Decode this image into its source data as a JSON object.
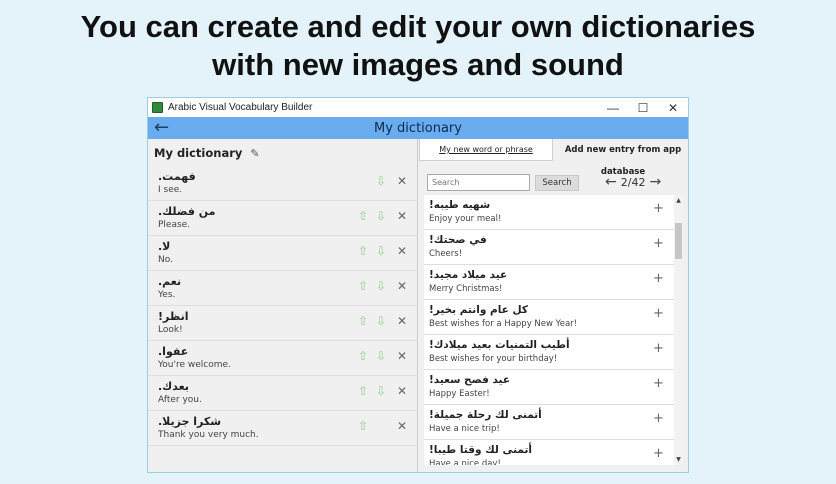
{
  "headline": {
    "line1": "You can create and edit your own dictionaries",
    "line2": "with new images and sound"
  },
  "window": {
    "title": "Arabic Visual Vocabulary Builder",
    "minimize": "—",
    "maximize": "☐",
    "close": "✕"
  },
  "appbar": {
    "back_icon": "←",
    "title": "My dictionary"
  },
  "left": {
    "title": "My dictionary",
    "edit_icon": "✎",
    "items": [
      {
        "ar": "فهمت.",
        "en": "I see.",
        "up": "",
        "down": "⇩",
        "remove": "✕"
      },
      {
        "ar": "من فضلك.",
        "en": "Please.",
        "up": "⇧",
        "down": "⇩",
        "remove": "✕"
      },
      {
        "ar": "لا.",
        "en": "No.",
        "up": "⇧",
        "down": "⇩",
        "remove": "✕"
      },
      {
        "ar": "نعم.",
        "en": "Yes.",
        "up": "⇧",
        "down": "⇩",
        "remove": "✕"
      },
      {
        "ar": "انظر!",
        "en": "Look!",
        "up": "⇧",
        "down": "⇩",
        "remove": "✕"
      },
      {
        "ar": "عفوا.",
        "en": "You're welcome.",
        "up": "⇧",
        "down": "⇩",
        "remove": "✕"
      },
      {
        "ar": "بعدك.",
        "en": "After you.",
        "up": "⇧",
        "down": "⇩",
        "remove": "✕"
      },
      {
        "ar": "شكرا جزيلا.",
        "en": "Thank you very much.",
        "up": "⇧",
        "down": "",
        "remove": "✕"
      }
    ]
  },
  "right": {
    "tab_active": "My new word or phrase",
    "tab_other": "Add new entry from app database",
    "search_placeholder": "Search",
    "search_button": "Search",
    "pager_prev": "←",
    "pager_text": "2/42",
    "pager_next": "→",
    "add_icon": "+",
    "scroll_up": "▲",
    "scroll_down": "▼",
    "items": [
      {
        "ar": "شهيه طيبه!",
        "en": "Enjoy your meal!"
      },
      {
        "ar": "في صحتك!",
        "en": "Cheers!"
      },
      {
        "ar": "عيد ميلاد مجيد!",
        "en": "Merry Christmas!"
      },
      {
        "ar": "كل عام وانتم بخير!",
        "en": "Best wishes for a Happy New Year!"
      },
      {
        "ar": "أطيب التمنيات بعيد ميلادك!",
        "en": "Best wishes for your birthday!"
      },
      {
        "ar": "عيد فصح سعيد!",
        "en": "Happy Easter!"
      },
      {
        "ar": "أتمنى لك رحلة جميلة!",
        "en": "Have a nice trip!"
      },
      {
        "ar": "أتمنى لك وقتا طيبا!",
        "en": "Have a nice day!"
      }
    ]
  }
}
